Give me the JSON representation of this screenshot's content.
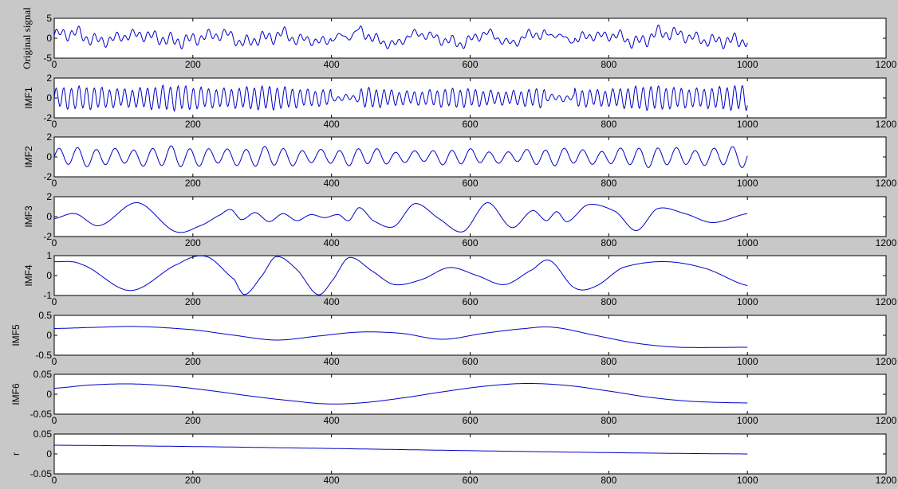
{
  "figure": {
    "background": "#c8c8c8",
    "axes_background": "#ffffff",
    "line_color": "#0000c8"
  },
  "chart_data": [
    {
      "type": "line",
      "ylabel": "Original signal",
      "xlabel": "",
      "xlim": [
        0,
        1200
      ],
      "ylim": [
        -5,
        5
      ],
      "xticks": [
        0,
        200,
        400,
        600,
        800,
        1000,
        1200
      ],
      "yticks": [
        5,
        0,
        -5
      ],
      "xtick_labels": [
        "0",
        "200",
        "400",
        "600",
        "800",
        "1000",
        "1200"
      ],
      "ytick_labels": [
        "5",
        "0",
        "-5"
      ],
      "x_end": 1000,
      "series": [
        {
          "kind": "sum_of_components",
          "amplitude_range": [
            -3.5,
            3.5
          ]
        }
      ]
    },
    {
      "type": "line",
      "ylabel": "IMF1",
      "xlabel": "",
      "xlim": [
        0,
        1200
      ],
      "ylim": [
        -2,
        2
      ],
      "xticks": [
        0,
        200,
        400,
        600,
        800,
        1000,
        1200
      ],
      "yticks": [
        2,
        0,
        -2
      ],
      "xtick_labels": [
        "0",
        "200",
        "400",
        "600",
        "800",
        "1000",
        "1200"
      ],
      "ytick_labels": [
        "2",
        "0",
        "-2"
      ],
      "x_end": 1000,
      "series": [
        {
          "kind": "oscillation",
          "amplitude": 1.2,
          "period": 11,
          "quiet_intervals": [
            [
              400,
              440
            ],
            [
              710,
              750
            ]
          ]
        }
      ]
    },
    {
      "type": "line",
      "ylabel": "IMF2",
      "xlabel": "",
      "xlim": [
        0,
        1200
      ],
      "ylim": [
        -2,
        2
      ],
      "xticks": [
        0,
        200,
        400,
        600,
        800,
        1000,
        1200
      ],
      "yticks": [
        2,
        0,
        -2
      ],
      "xtick_labels": [
        "0",
        "200",
        "400",
        "600",
        "800",
        "1000",
        "1200"
      ],
      "ytick_labels": [
        "2",
        "0",
        "-2"
      ],
      "x_end": 1000,
      "series": [
        {
          "kind": "oscillation",
          "amplitude": 1.0,
          "period": 27
        }
      ]
    },
    {
      "type": "line",
      "ylabel": "IMF3",
      "xlabel": "",
      "xlim": [
        0,
        1200
      ],
      "ylim": [
        -2,
        2
      ],
      "xticks": [
        0,
        200,
        400,
        600,
        800,
        1000,
        1200
      ],
      "yticks": [
        2,
        0,
        -2
      ],
      "xtick_labels": [
        "0",
        "200",
        "400",
        "600",
        "800",
        "1000",
        "1200"
      ],
      "ytick_labels": [
        "2",
        "0",
        "-2"
      ],
      "x_end": 1000,
      "series": [
        {
          "kind": "points",
          "x": [
            0,
            30,
            65,
            120,
            175,
            215,
            240,
            255,
            270,
            290,
            310,
            330,
            350,
            370,
            390,
            410,
            425,
            440,
            460,
            490,
            520,
            555,
            590,
            625,
            660,
            690,
            710,
            725,
            740,
            770,
            810,
            840,
            870,
            910,
            950,
            1000
          ],
          "y": [
            -0.2,
            0.3,
            -0.9,
            1.4,
            -1.5,
            -0.8,
            0.2,
            0.7,
            -0.3,
            0.4,
            -0.5,
            0.3,
            -0.4,
            0.2,
            -0.1,
            0.2,
            -0.4,
            0.9,
            -0.4,
            -1.0,
            1.3,
            -0.2,
            -1.5,
            1.4,
            -1.1,
            0.6,
            -0.4,
            0.5,
            -0.5,
            1.2,
            0.5,
            -1.4,
            0.8,
            0.3,
            -0.6,
            0.3
          ]
        }
      ]
    },
    {
      "type": "line",
      "ylabel": "IMF4",
      "xlabel": "",
      "xlim": [
        0,
        1200
      ],
      "ylim": [
        -1,
        1
      ],
      "xticks": [
        0,
        200,
        400,
        600,
        800,
        1000,
        1200
      ],
      "yticks": [
        1,
        0,
        -1
      ],
      "xtick_labels": [
        "0",
        "200",
        "400",
        "600",
        "800",
        "1000",
        "1200"
      ],
      "ytick_labels": [
        "1",
        "0",
        "-1"
      ],
      "x_end": 1000,
      "series": [
        {
          "kind": "points",
          "x": [
            0,
            40,
            110,
            180,
            220,
            260,
            275,
            300,
            320,
            350,
            380,
            400,
            425,
            460,
            490,
            530,
            570,
            610,
            650,
            690,
            715,
            750,
            780,
            820,
            880,
            940,
            1000
          ],
          "y": [
            0.7,
            0.55,
            -0.75,
            0.6,
            0.95,
            -0.2,
            -0.95,
            0.0,
            0.95,
            0.3,
            -0.95,
            -0.3,
            0.9,
            0.2,
            -0.45,
            -0.2,
            0.4,
            0.0,
            -0.45,
            0.3,
            0.75,
            -0.6,
            -0.55,
            0.4,
            0.7,
            0.35,
            -0.5
          ]
        }
      ]
    },
    {
      "type": "line",
      "ylabel": "IMF5",
      "xlabel": "",
      "xlim": [
        0,
        1200
      ],
      "ylim": [
        -0.5,
        0.5
      ],
      "xticks": [
        0,
        200,
        400,
        600,
        800,
        1000,
        1200
      ],
      "yticks": [
        0.5,
        0,
        -0.5
      ],
      "xtick_labels": [
        "0",
        "200",
        "400",
        "600",
        "800",
        "1000",
        "1200"
      ],
      "ytick_labels": [
        "0.5",
        "0",
        "-0.5"
      ],
      "x_end": 1000,
      "series": [
        {
          "kind": "points",
          "x": [
            0,
            60,
            120,
            200,
            260,
            320,
            380,
            440,
            500,
            560,
            620,
            680,
            720,
            780,
            840,
            900,
            1000
          ],
          "y": [
            0.17,
            0.2,
            0.22,
            0.14,
            0.0,
            -0.12,
            -0.02,
            0.08,
            0.05,
            -0.1,
            0.05,
            0.17,
            0.2,
            0.0,
            -0.2,
            -0.3,
            -0.3
          ]
        }
      ]
    },
    {
      "type": "line",
      "ylabel": "IMF6",
      "xlabel": "",
      "xlim": [
        0,
        1200
      ],
      "ylim": [
        -0.05,
        0.05
      ],
      "xticks": [
        0,
        200,
        400,
        600,
        800,
        1000,
        1200
      ],
      "yticks": [
        0.05,
        0,
        -0.05
      ],
      "xtick_labels": [
        "0",
        "200",
        "400",
        "600",
        "800",
        "1000",
        "1200"
      ],
      "ytick_labels": [
        "0.05",
        "0",
        "-0.05"
      ],
      "x_end": 1000,
      "series": [
        {
          "kind": "points",
          "x": [
            0,
            50,
            110,
            170,
            230,
            290,
            340,
            390,
            440,
            500,
            560,
            620,
            680,
            740,
            800,
            860,
            920,
            1000
          ],
          "y": [
            0.015,
            0.023,
            0.026,
            0.02,
            0.008,
            -0.006,
            -0.016,
            -0.024,
            -0.022,
            -0.01,
            0.006,
            0.02,
            0.027,
            0.022,
            0.008,
            -0.008,
            -0.018,
            -0.022
          ]
        }
      ]
    },
    {
      "type": "line",
      "ylabel": "r",
      "xlabel": "",
      "xlim": [
        0,
        1200
      ],
      "ylim": [
        -0.05,
        0.05
      ],
      "xticks": [
        0,
        200,
        400,
        600,
        800,
        1000,
        1200
      ],
      "yticks": [
        0.05,
        0,
        -0.05
      ],
      "xtick_labels": [
        "0",
        "200",
        "400",
        "600",
        "800",
        "1000",
        "1200"
      ],
      "ytick_labels": [
        "0.05",
        "0",
        "-0.05"
      ],
      "x_end": 1000,
      "series": [
        {
          "kind": "points",
          "x": [
            0,
            1000
          ],
          "y": [
            0.022,
            0.0
          ]
        }
      ]
    }
  ]
}
